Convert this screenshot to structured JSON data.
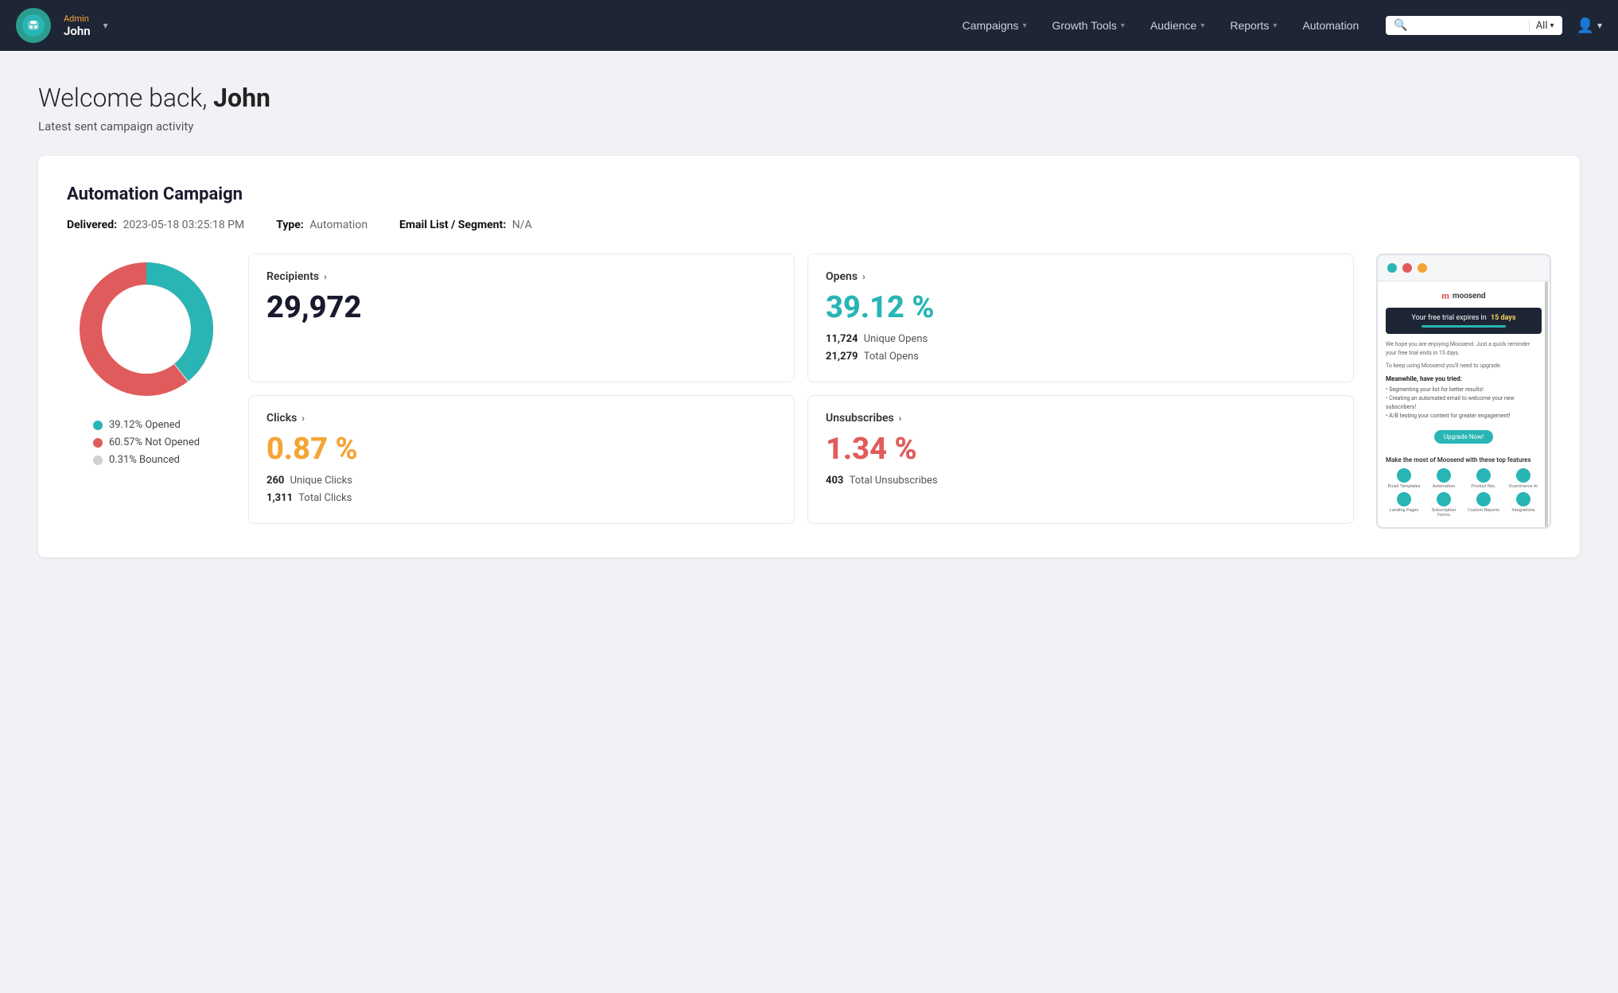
{
  "nav": {
    "user_role": "Admin",
    "user_name": "John",
    "items": [
      {
        "label": "Campaigns",
        "has_dropdown": true
      },
      {
        "label": "Growth Tools",
        "has_dropdown": true
      },
      {
        "label": "Audience",
        "has_dropdown": true
      },
      {
        "label": "Reports",
        "has_dropdown": true
      },
      {
        "label": "Automation",
        "has_dropdown": false
      }
    ],
    "search_placeholder": "",
    "search_filter": "All"
  },
  "page": {
    "welcome": "Welcome back,",
    "username": "John",
    "subtitle": "Latest sent campaign activity"
  },
  "campaign": {
    "title": "Automation Campaign",
    "delivered_label": "Delivered:",
    "delivered_value": "2023-05-18 03:25:18 PM",
    "type_label": "Type:",
    "type_value": "Automation",
    "email_list_label": "Email List / Segment:",
    "email_list_value": "N/A"
  },
  "donut": {
    "opened_pct": 39.12,
    "not_opened_pct": 60.57,
    "bounced_pct": 0.31,
    "colors": {
      "opened": "#2ab5b5",
      "not_opened": "#e05c5c",
      "bounced": "#d0d0d0"
    },
    "legend": [
      {
        "label": "39.12% Opened",
        "color": "#2ab5b5"
      },
      {
        "label": "60.57% Not Opened",
        "color": "#e05c5c"
      },
      {
        "label": "0.31% Bounced",
        "color": "#d0d0d0"
      }
    ]
  },
  "stats": {
    "recipients": {
      "label": "Recipients",
      "value": "29,972",
      "color": "dark"
    },
    "opens": {
      "label": "Opens",
      "value": "39.12 %",
      "color": "teal",
      "unique": "11,724",
      "unique_label": "Unique Opens",
      "total": "21,279",
      "total_label": "Total Opens"
    },
    "clicks": {
      "label": "Clicks",
      "value": "0.87 %",
      "color": "yellow",
      "unique": "260",
      "unique_label": "Unique Clicks",
      "total": "1,311",
      "total_label": "Total Clicks"
    },
    "unsubscribes": {
      "label": "Unsubscribes",
      "value": "1.34 %",
      "color": "red",
      "total": "403",
      "total_label": "Total Unsubscribes"
    }
  },
  "preview": {
    "banner_text": "Your free trial expires in",
    "banner_bold": "15 days",
    "heading": "Meanwhile, have you tried:",
    "list": [
      "Segmenting your list for better results!",
      "Creating an automated email to welcome your new subscribers!",
      "A/B testing your content for greater engagement!"
    ],
    "cta": "Upgrade Now!",
    "features_label": "Make the most of Moosend with these top features",
    "icons": [
      {
        "label": "Email Templates"
      },
      {
        "label": "Automation"
      },
      {
        "label": "Product Recommendations"
      },
      {
        "label": "Ecommerce AI"
      },
      {
        "label": "Landing Pages"
      },
      {
        "label": "Subscription Forms"
      },
      {
        "label": "Custom Reports"
      },
      {
        "label": "Integrations"
      }
    ]
  }
}
